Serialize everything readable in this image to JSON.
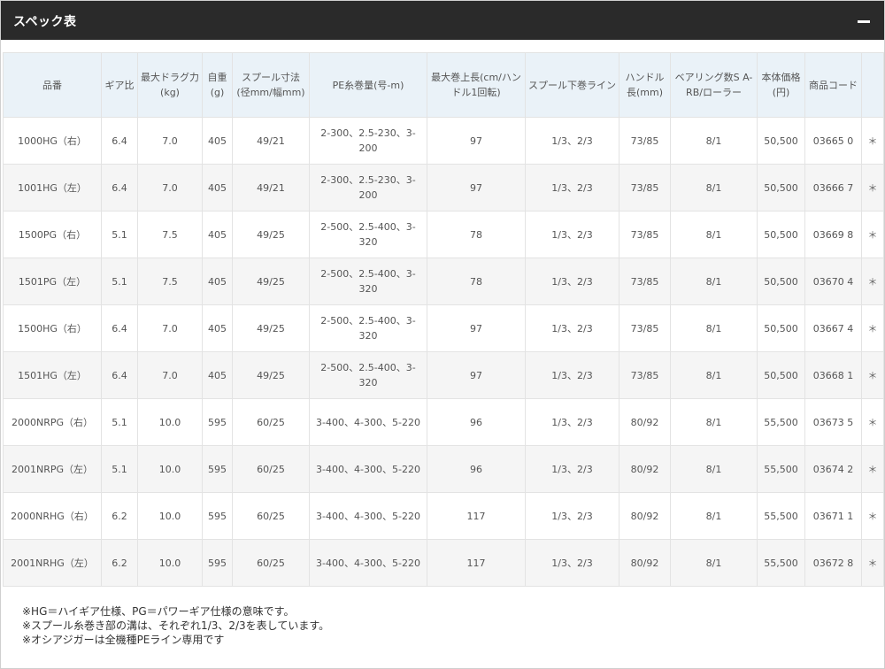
{
  "header": {
    "title": "スペック表",
    "collapse_icon": "minus-icon"
  },
  "table": {
    "columns": [
      "品番",
      "ギア比",
      "最大ドラグ力(kg)",
      "自重(g)",
      "スプール寸法(径mm/幅mm)",
      "PE糸巻量(号-m)",
      "最大巻上長(cm/ハンドル1回転)",
      "スプール下巻ライン",
      "ハンドル長(mm)",
      "ベアリング数S A-RB/ローラー",
      "本体価格(円)",
      "商品コード",
      ""
    ],
    "rows": [
      [
        "1000HG（右）",
        "6.4",
        "7.0",
        "405",
        "49/21",
        "2-300、2.5-230、3-200",
        "97",
        "1/3、2/3",
        "73/85",
        "8/1",
        "50,500",
        "03665 0",
        "＊"
      ],
      [
        "1001HG（左）",
        "6.4",
        "7.0",
        "405",
        "49/21",
        "2-300、2.5-230、3-200",
        "97",
        "1/3、2/3",
        "73/85",
        "8/1",
        "50,500",
        "03666 7",
        "＊"
      ],
      [
        "1500PG（右）",
        "5.1",
        "7.5",
        "405",
        "49/25",
        "2-500、2.5-400、3-320",
        "78",
        "1/3、2/3",
        "73/85",
        "8/1",
        "50,500",
        "03669 8",
        "＊"
      ],
      [
        "1501PG（左）",
        "5.1",
        "7.5",
        "405",
        "49/25",
        "2-500、2.5-400、3-320",
        "78",
        "1/3、2/3",
        "73/85",
        "8/1",
        "50,500",
        "03670 4",
        "＊"
      ],
      [
        "1500HG（右）",
        "6.4",
        "7.0",
        "405",
        "49/25",
        "2-500、2.5-400、3-320",
        "97",
        "1/3、2/3",
        "73/85",
        "8/1",
        "50,500",
        "03667 4",
        "＊"
      ],
      [
        "1501HG（左）",
        "6.4",
        "7.0",
        "405",
        "49/25",
        "2-500、2.5-400、3-320",
        "97",
        "1/3、2/3",
        "73/85",
        "8/1",
        "50,500",
        "03668 1",
        "＊"
      ],
      [
        "2000NRPG（右）",
        "5.1",
        "10.0",
        "595",
        "60/25",
        "3-400、4-300、5-220",
        "96",
        "1/3、2/3",
        "80/92",
        "8/1",
        "55,500",
        "03673 5",
        "＊"
      ],
      [
        "2001NRPG（左）",
        "5.1",
        "10.0",
        "595",
        "60/25",
        "3-400、4-300、5-220",
        "96",
        "1/3、2/3",
        "80/92",
        "8/1",
        "55,500",
        "03674 2",
        "＊"
      ],
      [
        "2000NRHG（右）",
        "6.2",
        "10.0",
        "595",
        "60/25",
        "3-400、4-300、5-220",
        "117",
        "1/3、2/3",
        "80/92",
        "8/1",
        "55,500",
        "03671 1",
        "＊"
      ],
      [
        "2001NRHG（左）",
        "6.2",
        "10.0",
        "595",
        "60/25",
        "3-400、4-300、5-220",
        "117",
        "1/3、2/3",
        "80/92",
        "8/1",
        "55,500",
        "03672 8",
        "＊"
      ]
    ]
  },
  "notes": [
    "※HG＝ハイギア仕様、PG＝パワーギア仕様の意味です。",
    "※スプール糸巻き部の溝は、それぞれ1/3、2/3を表しています。",
    "※オシアジガーは全機種PEライン専用です"
  ]
}
